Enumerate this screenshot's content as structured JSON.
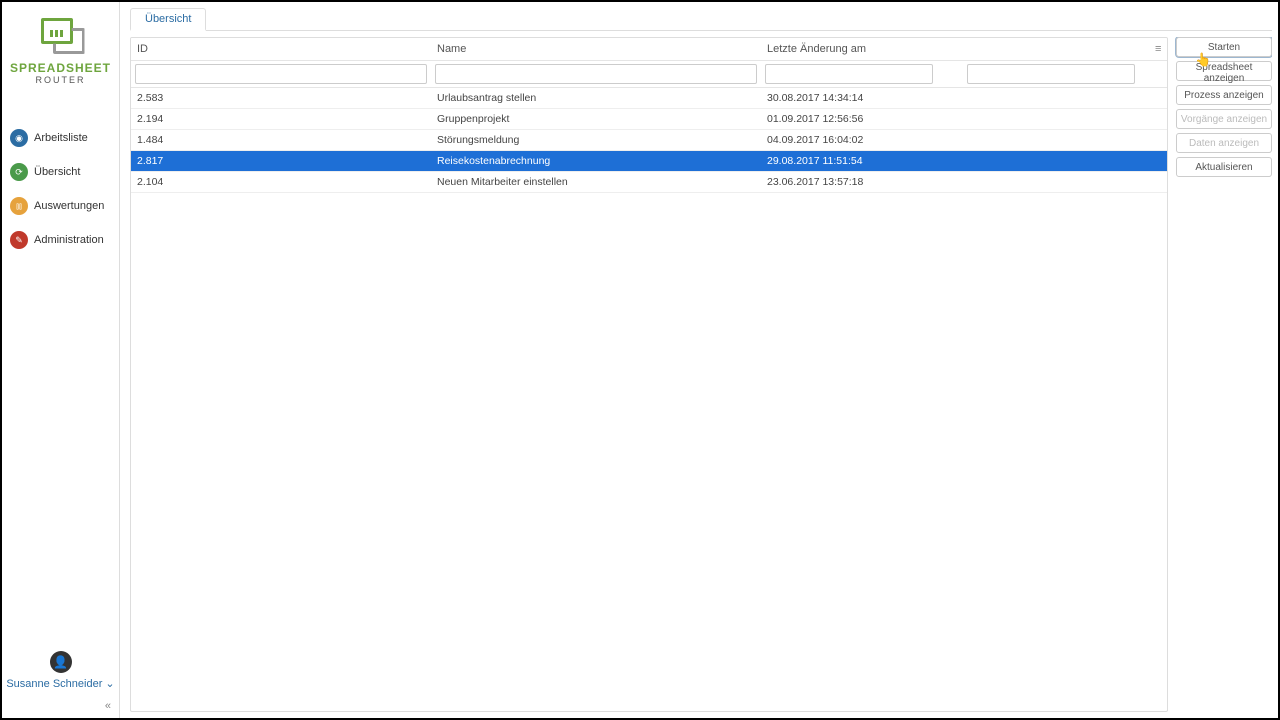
{
  "brand": {
    "line1": "SPREADSHEET",
    "line2": "ROUTER"
  },
  "nav": {
    "worklist": "Arbeitsliste",
    "overview": "Übersicht",
    "reports": "Auswertungen",
    "admin": "Administration"
  },
  "user": {
    "name": "Susanne Schneider"
  },
  "tabs": {
    "overview": "Übersicht"
  },
  "columns": {
    "id": "ID",
    "name": "Name",
    "date": "Letzte Änderung am"
  },
  "rows": [
    {
      "id": "2.583",
      "name": "Urlaubsantrag stellen",
      "date": "30.08.2017 14:34:14",
      "selected": false
    },
    {
      "id": "2.194",
      "name": "Gruppenprojekt",
      "date": "01.09.2017 12:56:56",
      "selected": false
    },
    {
      "id": "1.484",
      "name": "Störungsmeldung",
      "date": "04.09.2017 16:04:02",
      "selected": false
    },
    {
      "id": "2.817",
      "name": "Reisekostenabrechnung",
      "date": "29.08.2017 11:51:54",
      "selected": true
    },
    {
      "id": "2.104",
      "name": "Neuen Mitarbeiter einstellen",
      "date": "23.06.2017 13:57:18",
      "selected": false
    }
  ],
  "actions": {
    "start": "Starten",
    "showSpreadsheet": "Spreadsheet anzeigen",
    "showProcess": "Prozess anzeigen",
    "showHistory": "Vorgänge anzeigen",
    "showData": "Daten anzeigen",
    "refresh": "Aktualisieren"
  },
  "glyphs": {
    "menu": "≡",
    "collapse": "«",
    "chevdown": "⌄"
  }
}
